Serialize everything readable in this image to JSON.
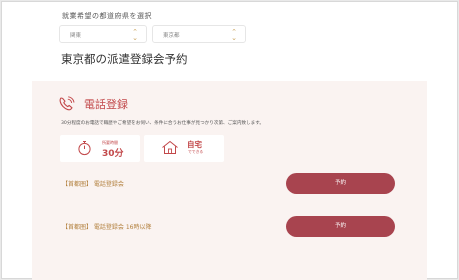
{
  "prefecture_section": {
    "label": "就業希望の都道府県を選択",
    "region_select": "関東",
    "pref_select": "東京都"
  },
  "page_title": "東京都の派遣登録会予約",
  "phone_section": {
    "title": "電話登録",
    "description": "30分程度のお電話で職歴やご希望をお伺い、条件に合うお仕事が見つかり次第、ご案内致します。",
    "feature_time_small": "所要時間",
    "feature_time_big": "30分",
    "feature_home_big": "自宅",
    "feature_home_small": "でできる"
  },
  "sessions": [
    {
      "label": "【首都圏】 電話登録会",
      "button": "予約"
    },
    {
      "label": "【首都圏】 電話登録会 16時以降",
      "button": "予約"
    }
  ],
  "colors": {
    "accent_red": "#c2484a",
    "button": "#a8444f",
    "session_text": "#b3813f",
    "panel_bg": "#faf3f1"
  }
}
